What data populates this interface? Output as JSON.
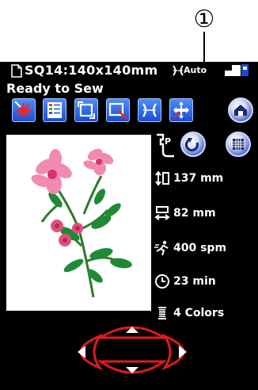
{
  "callout": "①",
  "title_bar": {
    "title": "SQ14:140x140mm",
    "auto": "Auto"
  },
  "status": "Ready to Sew",
  "info": {
    "height": "137 mm",
    "width": "82 mm",
    "speed": "400 spm",
    "time": "23 min",
    "colors": "4 Colors"
  }
}
